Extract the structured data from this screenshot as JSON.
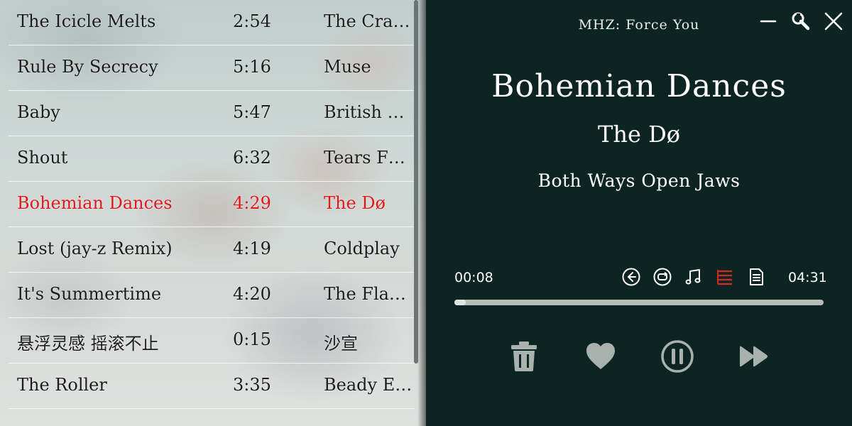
{
  "playlist": {
    "tracks": [
      {
        "title": "The Icicle Melts",
        "duration": "2:54",
        "artist": "The Cra…",
        "active": false
      },
      {
        "title": "Rule By Secrecy",
        "duration": "5:16",
        "artist": "Muse",
        "active": false
      },
      {
        "title": "Baby",
        "duration": "5:47",
        "artist": "British …",
        "active": false
      },
      {
        "title": "Shout",
        "duration": "6:32",
        "artist": "Tears F…",
        "active": false
      },
      {
        "title": "Bohemian Dances",
        "duration": "4:29",
        "artist": "The Dø",
        "active": true
      },
      {
        "title": "Lost (jay-z Remix)",
        "duration": "4:19",
        "artist": "Coldplay",
        "active": false
      },
      {
        "title": "It's Summertime",
        "duration": "4:20",
        "artist": "The Fla…",
        "active": false
      },
      {
        "title": "悬浮灵感 摇滚不止",
        "duration": "0:15",
        "artist": "沙宣",
        "active": false
      },
      {
        "title": "The Roller",
        "duration": "3:35",
        "artist": "Beady Eye",
        "active": false
      }
    ],
    "active_color": "#e0181c"
  },
  "window": {
    "title": "MHZ: Force You",
    "controls": [
      "minimize-icon",
      "wrench-icon",
      "close-icon"
    ]
  },
  "now_playing": {
    "title": "Bohemian Dances",
    "artist": "The Dø",
    "album": "Both Ways Open Jaws",
    "current_time": "00:08",
    "total_time": "04:31",
    "progress": 0.03
  },
  "toolbar": {
    "icons": [
      "previous-circle-icon",
      "repeat-circle-icon",
      "music-note-icon",
      "playlist-icon",
      "lyrics-document-icon"
    ],
    "active_icon": "playlist-icon",
    "accent": "#d42a22"
  },
  "playback_controls": [
    "trash-icon",
    "heart-icon",
    "pause-circle-icon",
    "fast-forward-icon"
  ]
}
